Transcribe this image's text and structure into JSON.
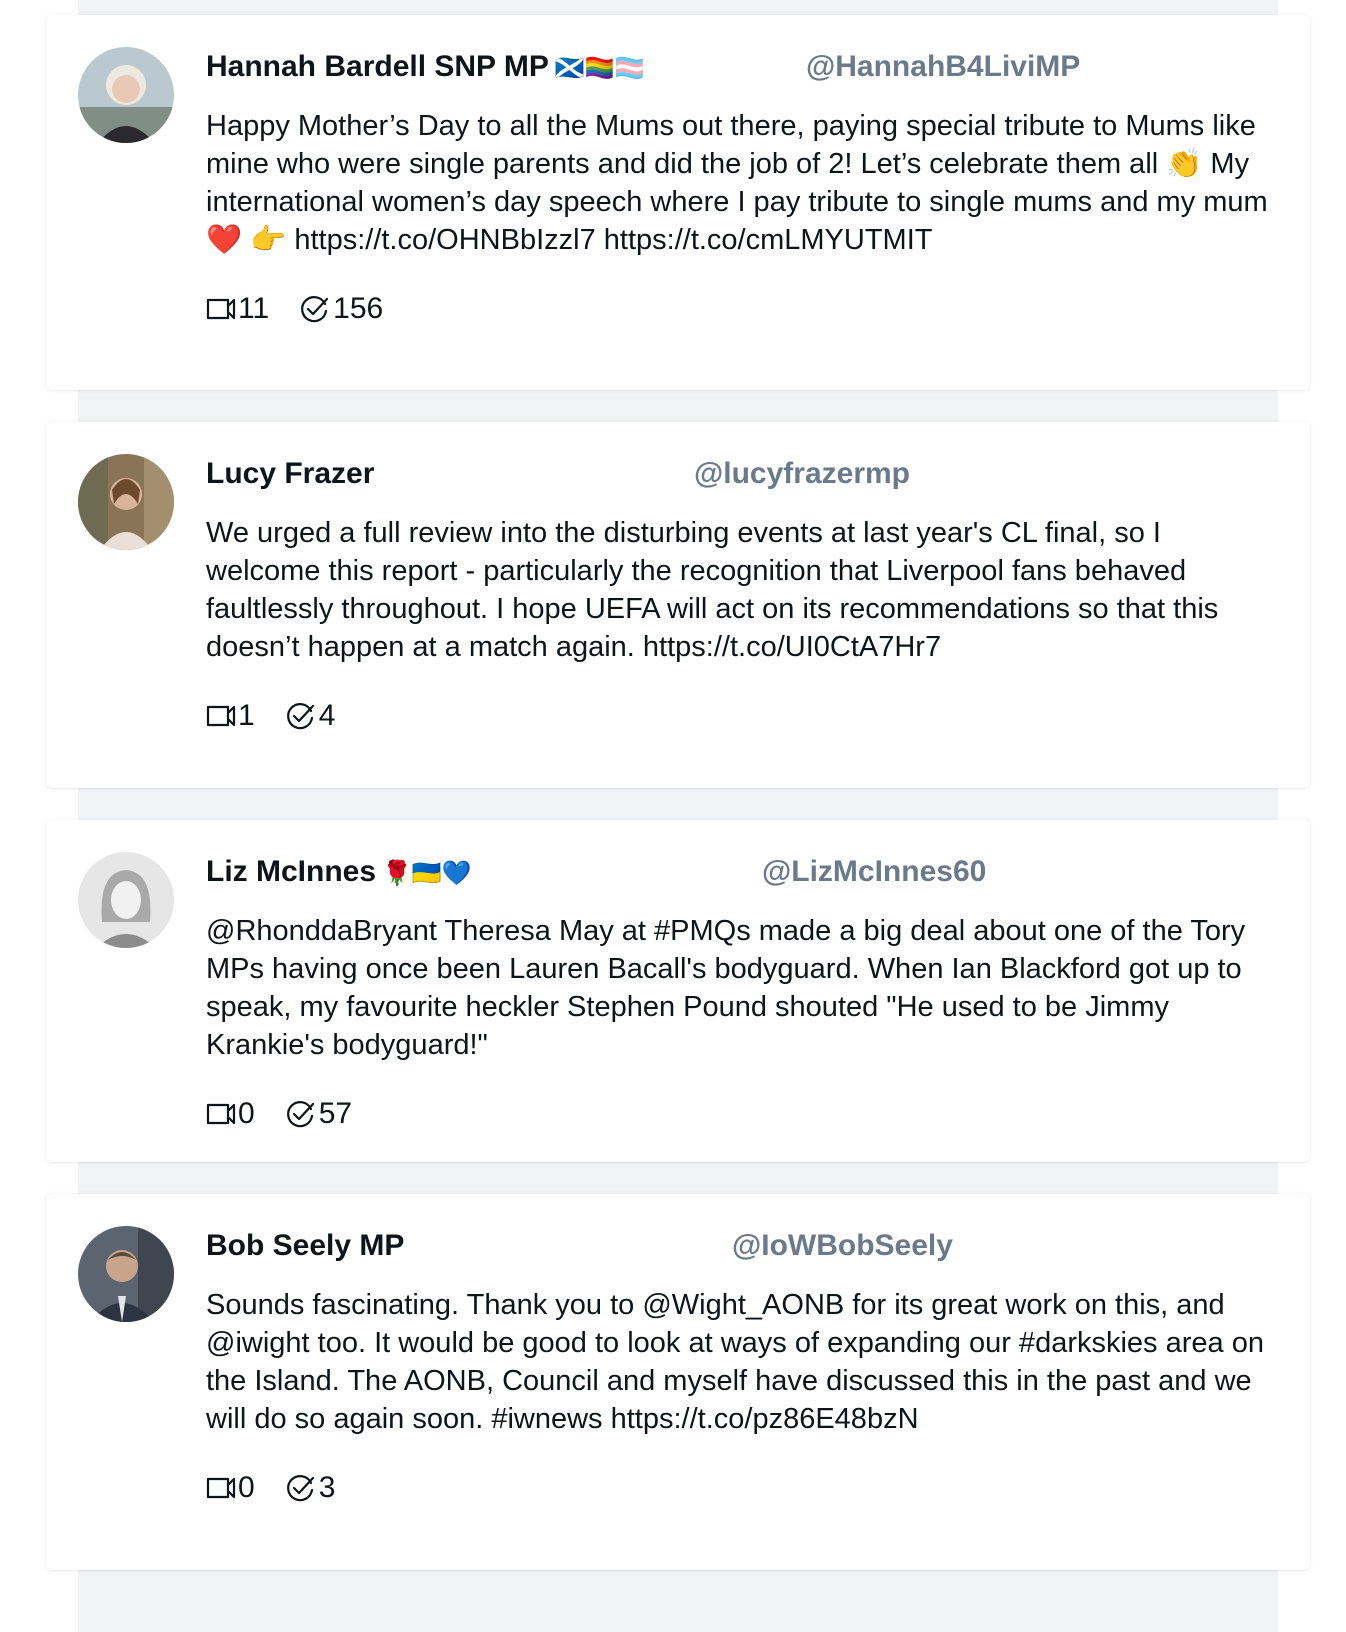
{
  "tweets": [
    {
      "name": "Hannah Bardell SNP MP",
      "emoji": "🏴󠁧󠁢󠁳󠁣󠁴󠁿🏳️‍🌈🏳️‍⚧️",
      "handle": "@HannahB4LiviMP",
      "text": "Happy Mother’s Day to all the Mums out there, paying special tribute to Mums like mine who were single parents and did the job of 2! Let’s celebrate them all 👏 My international women’s day speech where I pay tribute to single mums and my mum ❤️ 👉 https://t.co/OHNBbIzzl7 https://t.co/cmLMYUTMIT",
      "replies": "11",
      "likes": "156"
    },
    {
      "name": "Lucy Frazer",
      "emoji": "",
      "handle": "@lucyfrazermp",
      "text": "We urged a full review into the disturbing events at last year's CL final, so I welcome this report - particularly the recognition that Liverpool fans behaved faultlessly throughout. I hope UEFA will act on its recommendations so that this doesn’t happen at a match again. https://t.co/UI0CtA7Hr7",
      "replies": "1",
      "likes": "4"
    },
    {
      "name": "Liz McInnes",
      "emoji": "🌹🇺🇦💙",
      "handle": "@LizMcInnes60",
      "text": "@RhonddaBryant Theresa May at #PMQs made a big deal about one of the Tory MPs having once been Lauren Bacall's bodyguard. When Ian Blackford got up to speak, my favourite heckler Stephen Pound shouted \"He used to be Jimmy Krankie's bodyguard!\"",
      "replies": "0",
      "likes": "57"
    },
    {
      "name": "Bob Seely MP",
      "emoji": "",
      "handle": "@IoWBobSeely",
      "text": "Sounds fascinating. Thank you to @Wight_AONB for its great work on this, and @iwight too. It would be good to look at ways of expanding our #darkskies area on the Island. The AONB, Council and myself have discussed this in the past and we will do so again soon. #iwnews https://t.co/pz86E48bzN",
      "replies": "0",
      "likes": "3"
    }
  ]
}
